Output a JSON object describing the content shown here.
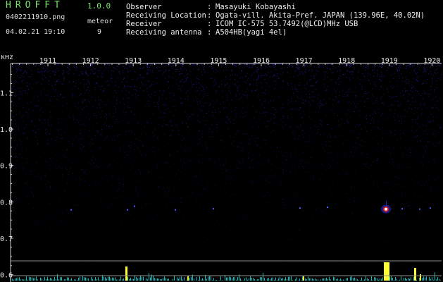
{
  "app": {
    "name": "HROFFT",
    "version": "1.0.0"
  },
  "file": {
    "name": "0402211910.png",
    "datetime": "04.02.21 19:10"
  },
  "meteor": {
    "label": "meteor",
    "count": "9"
  },
  "info": [
    {
      "key": "Observer",
      "value": "Masayuki Kobayashi"
    },
    {
      "key": "Receiving Location",
      "value": "Ogata-vill. Akita-Pref. JAPAN (139.96E, 40.02N)"
    },
    {
      "key": "Receiver",
      "value": "ICOM IC-575 53.7492(@LCD)MHz USB"
    },
    {
      "key": "Receiving antenna",
      "value": "A504HB(yagi 4el)"
    }
  ],
  "chart_data": {
    "type": "heatmap",
    "ylabel": "kHz",
    "x_ticks": [
      "1911",
      "1912",
      "1913",
      "1914",
      "1915",
      "1916",
      "1917",
      "1918",
      "1919",
      "1920"
    ],
    "y_ticks": [
      "1.1",
      "1.0",
      "0.9",
      "0.8",
      "0.7",
      "0.6"
    ],
    "ylim": [
      0.58,
      1.18
    ],
    "colors": {
      "background": "#000000",
      "noise": "#1f1fa8",
      "echo_mid": "#d02020",
      "echo_core": "#ffffff",
      "signal": "#ffff33",
      "baseline": "#00c8c8"
    }
  }
}
